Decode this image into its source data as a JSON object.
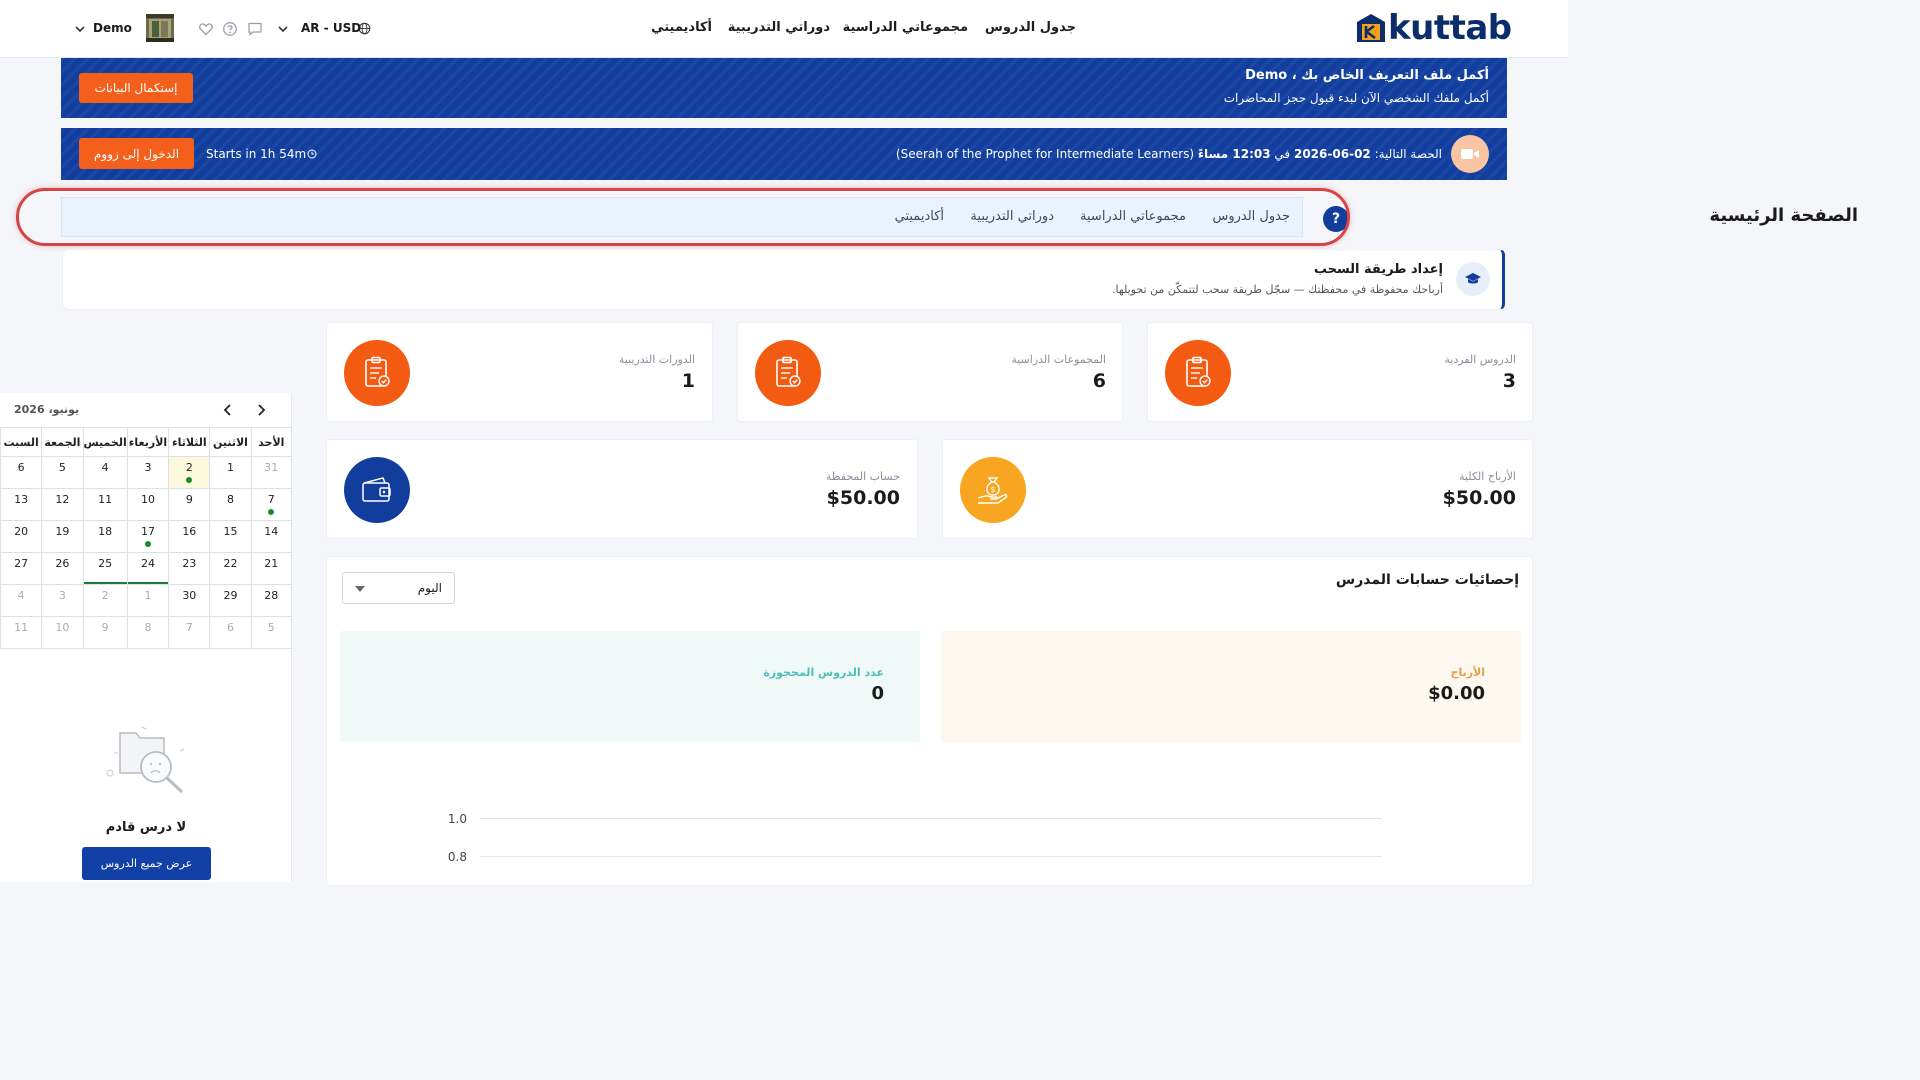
{
  "header": {
    "logo_text": "kuttab",
    "nav": [
      "جدول الدروس",
      "مجموعاتي الدراسية",
      "دوراتي التدريبية",
      "أكاديميتي"
    ],
    "locale": "AR - USD",
    "user_name": "Demo",
    "icons": [
      "globe-icon",
      "chevron-down-icon",
      "chat-icon",
      "help-icon",
      "heart-icon",
      "avatar"
    ]
  },
  "profile_banner": {
    "title": "أكمل ملف التعريف الخاص بك ، Demo",
    "subtitle": "أكمل ملفك الشخصي الآن لبدء قبول حجز المحاضرات",
    "button": "إستكمال البيانات"
  },
  "next_session": {
    "prefix": "الحصة التالية: ",
    "date": "02-06-2026",
    "in_word": "في",
    "time": "12:03 مساءً",
    "course": "(Seerah of the Prophet for Intermediate Learners)",
    "countdown": "Starts in 1h 54m",
    "button": "الدخول إلى زووم"
  },
  "page": {
    "title": "الصفحة الرئيسية",
    "tabs": [
      "جدول الدروس",
      "مجموعاتي الدراسية",
      "دوراتي التدريبية",
      "أكاديميتي"
    ]
  },
  "withdraw_notice": {
    "title": "إعداد طريقة السحب",
    "text": "أرباحك محفوظة في محفظتك — سجّل طريقة سحب لتتمكّن من تحويلها."
  },
  "stats": [
    {
      "label": "الدروس الفردية",
      "value": "3",
      "color": "#f35b12"
    },
    {
      "label": "المجموعات الدراسية",
      "value": "6",
      "color": "#f35b12"
    },
    {
      "label": "الدورات التدريبية",
      "value": "1",
      "color": "#f35b12"
    }
  ],
  "money": [
    {
      "label": "الأرباح الكلية",
      "value": "$50.00",
      "color": "#f8a521"
    },
    {
      "label": "حساب المحفظة",
      "value": "$50.00",
      "color": "#113d9c"
    }
  ],
  "teacher_stats": {
    "title": "إحصائيات حسابات المدرس",
    "period": "اليوم",
    "earnings_label": "الأرباح",
    "earnings_value": "$0.00",
    "lessons_label": "عدد الدروس المحجوزة",
    "lessons_value": "0",
    "chart_data": {
      "type": "line",
      "y_ticks": [
        "1.0",
        "0.8"
      ],
      "series": []
    }
  },
  "calendar": {
    "month_label": "يونيو، 2026",
    "weekdays": [
      "الأحد",
      "الاثنين",
      "الثلاثاء",
      "الأربعاء",
      "الخميس",
      "الجمعة",
      "السبت"
    ],
    "weeks": [
      [
        {
          "d": "31",
          "m": true
        },
        {
          "d": "1"
        },
        {
          "d": "2",
          "today": true,
          "dot": true
        },
        {
          "d": "3"
        },
        {
          "d": "4"
        },
        {
          "d": "5"
        },
        {
          "d": "6"
        }
      ],
      [
        {
          "d": "7",
          "dot": true
        },
        {
          "d": "8"
        },
        {
          "d": "9"
        },
        {
          "d": "10"
        },
        {
          "d": "11"
        },
        {
          "d": "12"
        },
        {
          "d": "13"
        }
      ],
      [
        {
          "d": "14"
        },
        {
          "d": "15"
        },
        {
          "d": "16"
        },
        {
          "d": "17",
          "dot": true
        },
        {
          "d": "18"
        },
        {
          "d": "19"
        },
        {
          "d": "20"
        }
      ],
      [
        {
          "d": "21"
        },
        {
          "d": "22"
        },
        {
          "d": "23"
        },
        {
          "d": "24",
          "under": true
        },
        {
          "d": "25",
          "under": true
        },
        {
          "d": "26"
        },
        {
          "d": "27"
        }
      ],
      [
        {
          "d": "28"
        },
        {
          "d": "29"
        },
        {
          "d": "30"
        },
        {
          "d": "1",
          "m": true
        },
        {
          "d": "2",
          "m": true
        },
        {
          "d": "3",
          "m": true
        },
        {
          "d": "4",
          "m": true
        }
      ],
      [
        {
          "d": "5",
          "m": true
        },
        {
          "d": "6",
          "m": true
        },
        {
          "d": "7",
          "m": true
        },
        {
          "d": "8",
          "m": true
        },
        {
          "d": "9",
          "m": true
        },
        {
          "d": "10",
          "m": true
        },
        {
          "d": "11",
          "m": true
        }
      ]
    ],
    "empty_title": "لا درس قادم",
    "empty_button": "عرض جميع الدروس"
  }
}
